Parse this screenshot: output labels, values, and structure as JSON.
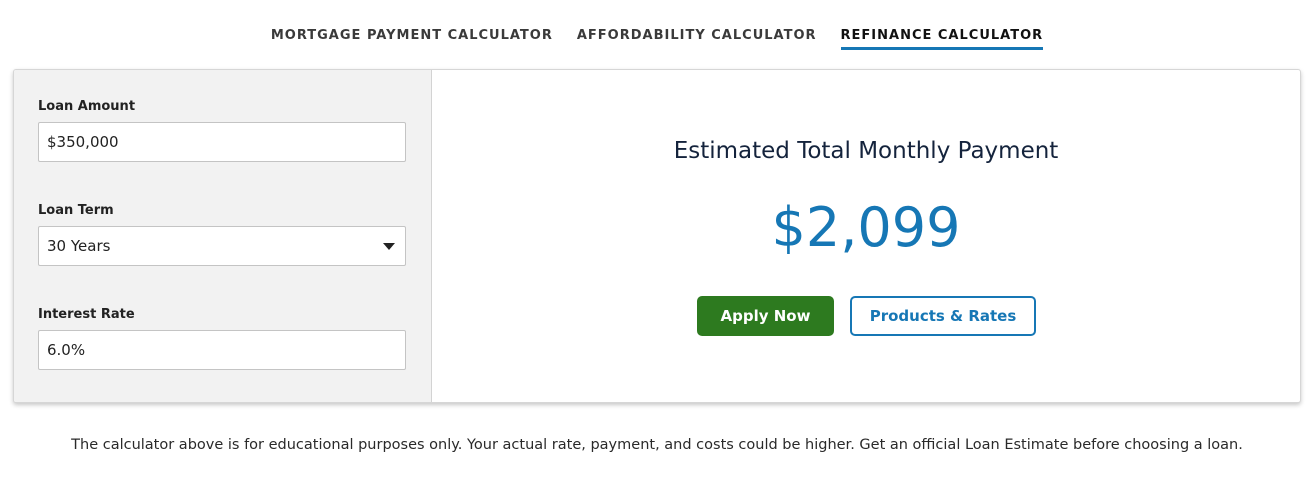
{
  "tabs": [
    {
      "label": "MORTGAGE PAYMENT CALCULATOR",
      "active": false
    },
    {
      "label": "AFFORDABILITY CALCULATOR",
      "active": false
    },
    {
      "label": "REFINANCE CALCULATOR",
      "active": true
    }
  ],
  "form": {
    "loan_amount": {
      "label": "Loan Amount",
      "value": "$350,000"
    },
    "loan_term": {
      "label": "Loan Term",
      "value": "30 Years"
    },
    "interest_rate": {
      "label": "Interest Rate",
      "value": "6.0%"
    }
  },
  "result": {
    "title": "Estimated Total Monthly Payment",
    "amount": "$2,099"
  },
  "buttons": {
    "apply": "Apply Now",
    "rates": "Products & Rates"
  },
  "disclaimer": "The calculator above is for educational purposes only. Your actual rate, payment, and costs could be higher. Get an official Loan Estimate before choosing a loan.",
  "colors": {
    "accent": "#1677b5",
    "apply_button": "#2d7a1f",
    "title_text": "#14233c"
  },
  "icons": {
    "loan_term_dropdown": "caret-down-icon"
  }
}
